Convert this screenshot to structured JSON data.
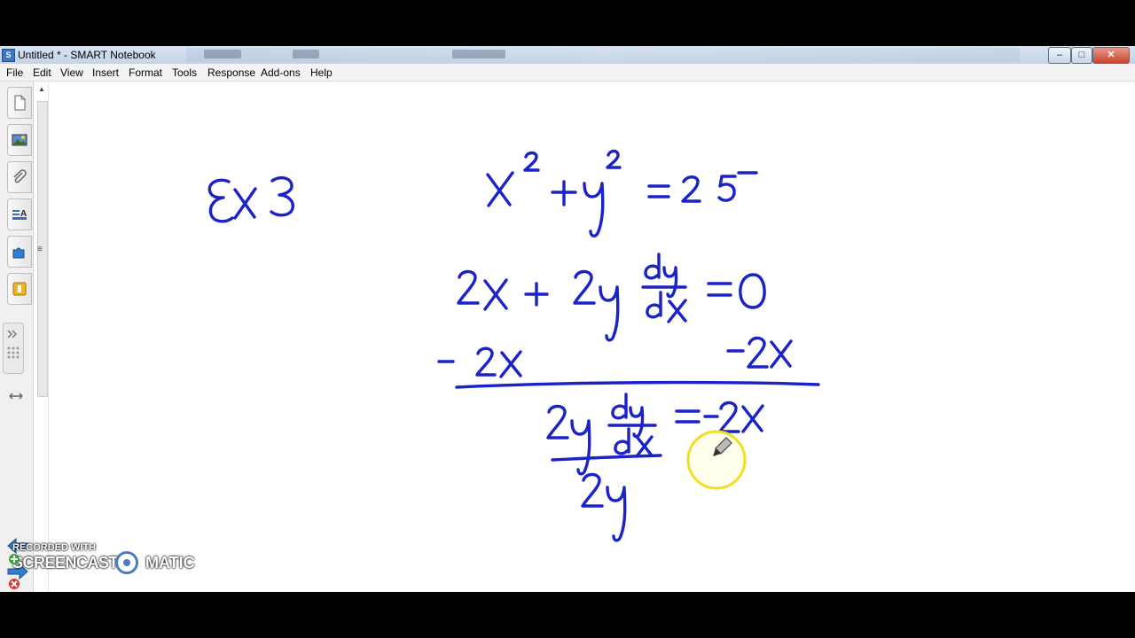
{
  "window": {
    "title": "Untitled * - SMART Notebook",
    "app_icon": "smart-notebook-icon",
    "controls": [
      "minimize",
      "maximize",
      "close"
    ]
  },
  "menu": [
    "File",
    "Edit",
    "View",
    "Insert",
    "Format",
    "Tools",
    "Response",
    "Add-ons",
    "Help"
  ],
  "sidebar": {
    "tabs": [
      {
        "name": "page-sorter-icon"
      },
      {
        "name": "gallery-icon"
      },
      {
        "name": "attachments-icon"
      },
      {
        "name": "properties-icon"
      },
      {
        "name": "add-ons-icon"
      },
      {
        "name": "response-icon"
      }
    ],
    "nav": [
      "previous-page-arrow-icon",
      "next-page-arrow-icon"
    ],
    "page_actions": [
      "add-page-icon",
      "delete-page-icon"
    ]
  },
  "canvas": {
    "ink_color": "#1a22c8",
    "highlight_color": "#f0e020",
    "handwriting": {
      "label": "Ex 3",
      "line1": "x² + y² = 25",
      "line2": "2x + 2y dy/dx = 0",
      "line3": "−2x   −2x",
      "line4": "2y dy/dx = −2x",
      "line5": "2y"
    }
  },
  "watermark": {
    "top": "RECORDED WITH",
    "left": "SCREENCAST",
    "right": "MATIC"
  }
}
